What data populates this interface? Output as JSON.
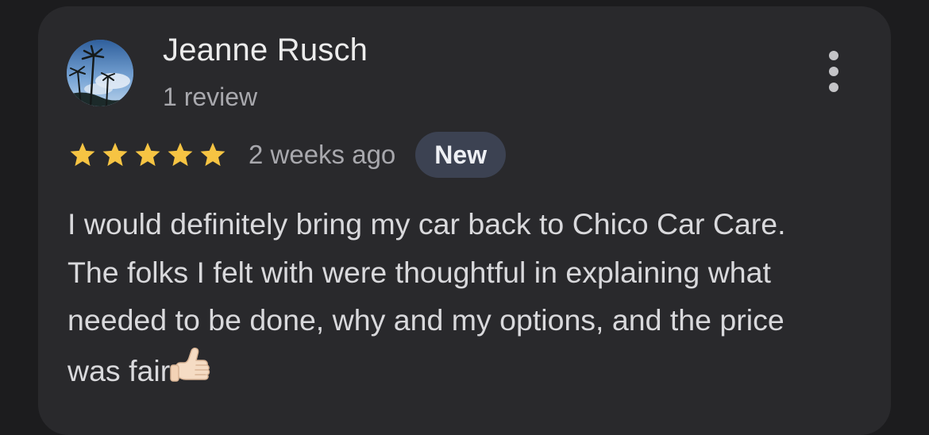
{
  "review": {
    "reviewer_name": "Jeanne Rusch",
    "review_count": "1 review",
    "rating": 5,
    "rating_max": 5,
    "time_ago": "2 weeks ago",
    "badge": "New",
    "text": "I would definitely bring my car back to Chico Car Care. The folks I felt with were thoughtful in explaining what needed to be done, why and my options, and the price was fair",
    "emoji": "thumbs-up-icon"
  },
  "colors": {
    "background": "#1c1c1e",
    "card": "#29292c",
    "star": "#f6c443",
    "badge_bg": "#3c4252",
    "primary_text": "#ececec",
    "secondary_text": "#a8a8ad"
  }
}
